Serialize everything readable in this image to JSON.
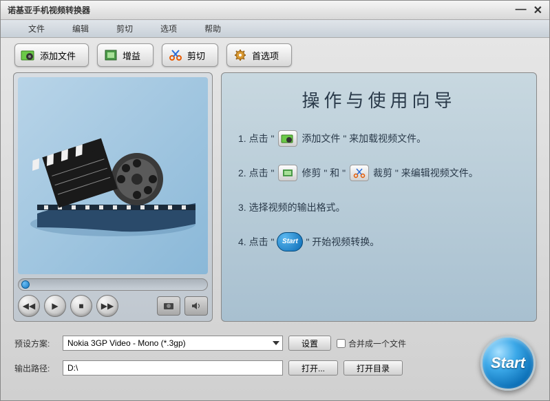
{
  "window": {
    "title": "诺基亚手机视频转换器"
  },
  "menu": {
    "file": "文件",
    "edit": "编辑",
    "cut": "剪切",
    "options": "选项",
    "help": "帮助"
  },
  "toolbar": {
    "add": "添加文件",
    "gain": "增益",
    "cut": "剪切",
    "prefs": "首选项"
  },
  "guide": {
    "title": "操作与使用向导",
    "s1a": "1.  点击  \"",
    "s1b": "添加文件  \"  来加载视频文件。",
    "s2a": "2.  点击  \"",
    "s2b": "修剪   \"  和  \"",
    "s2c": "裁剪  \"  来编辑视频文件。",
    "s3": "3.  选择视频的输出格式。",
    "s4a": "4.  点击  \"",
    "s4b": "\"  开始视频转换。",
    "start_inline": "Start"
  },
  "form": {
    "profile_label": "预设方案:",
    "profile_value": "Nokia 3GP Video - Mono (*.3gp)",
    "settings_btn": "设置",
    "merge_label": "合并成一个文件",
    "output_label": "输出路径:",
    "output_value": "D:\\",
    "open_btn": "打开...",
    "open_dir_btn": "打开目录"
  },
  "start_btn": "Start"
}
